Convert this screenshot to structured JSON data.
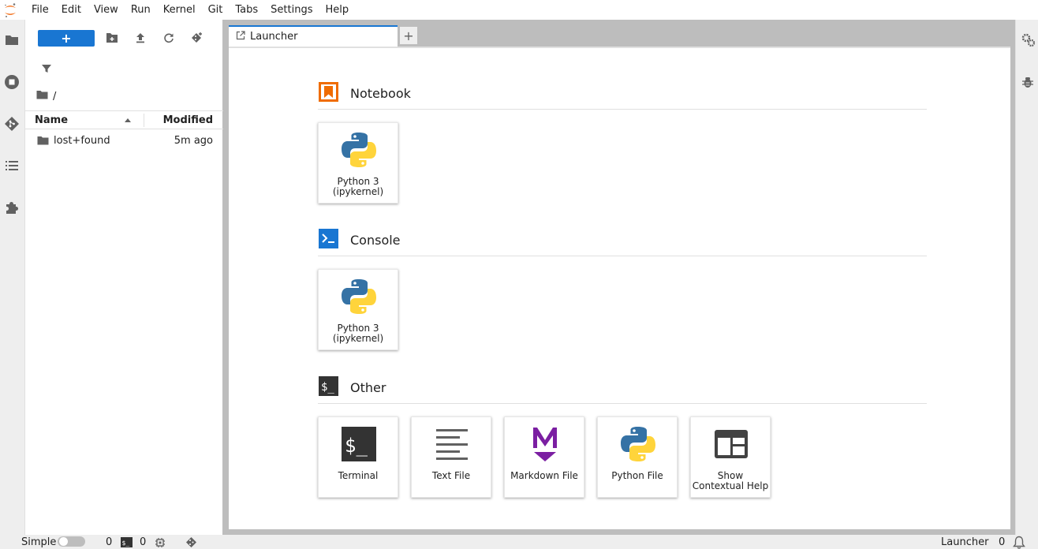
{
  "menubar": {
    "items": [
      "File",
      "Edit",
      "View",
      "Run",
      "Kernel",
      "Git",
      "Tabs",
      "Settings",
      "Help"
    ]
  },
  "left_bar": {
    "icons": [
      "folder-icon",
      "running-icon",
      "git-icon",
      "toc-icon",
      "extension-icon"
    ]
  },
  "filebrowser": {
    "new_label": "+",
    "breadcrumb": "/",
    "columns": {
      "name": "Name",
      "modified": "Modified"
    },
    "rows": [
      {
        "name": "lost+found",
        "modified": "5m ago"
      }
    ]
  },
  "tabs": {
    "active_label": "Launcher",
    "add_label": "+"
  },
  "launcher": {
    "notebook": {
      "title": "Notebook",
      "cards": [
        {
          "line1": "Python 3",
          "line2": "(ipykernel)"
        }
      ]
    },
    "console": {
      "title": "Console",
      "cards": [
        {
          "line1": "Python 3",
          "line2": "(ipykernel)"
        }
      ]
    },
    "other": {
      "title": "Other",
      "cards": [
        {
          "line1": "Terminal",
          "line2": ""
        },
        {
          "line1": "Text File",
          "line2": ""
        },
        {
          "line1": "Markdown File",
          "line2": ""
        },
        {
          "line1": "Python File",
          "line2": ""
        },
        {
          "line1": "Show",
          "line2": "Contextual Help"
        }
      ]
    }
  },
  "statusbar": {
    "mode_label": "Simple",
    "terminals_count": "0",
    "kernels_count": "0",
    "active_label": "Launcher",
    "notifications_count": "0"
  },
  "colors": {
    "accent": "#1976d2",
    "notebook_orange": "#ef6c00",
    "markdown_purple": "#7b1fa2",
    "python_blue": "#3572a5",
    "python_yellow": "#ffd43b"
  }
}
